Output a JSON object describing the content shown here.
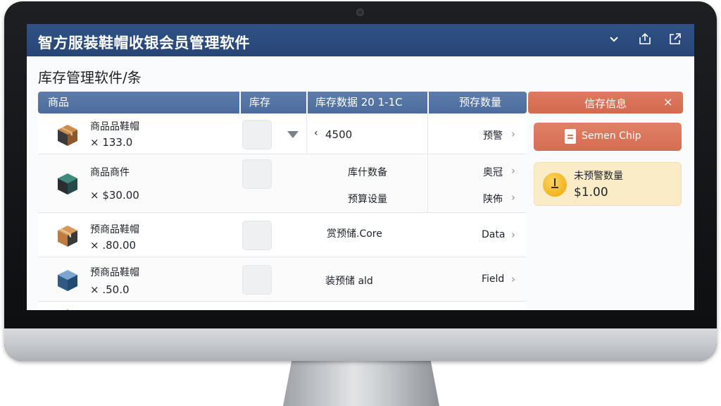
{
  "app": {
    "title": "智方服装鞋帽收银会员管理软件",
    "icons": [
      "chevron-down-icon",
      "share-icon",
      "export-icon"
    ]
  },
  "page": {
    "heading": "库存管理软件/条"
  },
  "table": {
    "headers": [
      "商品",
      "库存",
      "库存数据 20 1-1C",
      "预存数量"
    ],
    "rows": [
      {
        "name": "商品品鞋帽",
        "price": "× 133.0",
        "value": "4500",
        "status": "预警"
      },
      {
        "name": "商品商件",
        "price": "× $30.00",
        "mid1": "库什数备",
        "mid2": "预算设量",
        "status1": "奥冠",
        "status2": "陕佈"
      },
      {
        "name": "预商品鞋帽",
        "price": "× .80.00",
        "mid": "赏预储.Core",
        "status": "Data"
      },
      {
        "name": "预商品鞋帽",
        "price": "× .50.0",
        "mid": "装预储 ald",
        "status": "Field"
      }
    ]
  },
  "panel": {
    "title": "信存信息",
    "close": "×",
    "chip_label": "Semen Chip",
    "info_label": "未预警数量",
    "info_value": "$1.00"
  }
}
